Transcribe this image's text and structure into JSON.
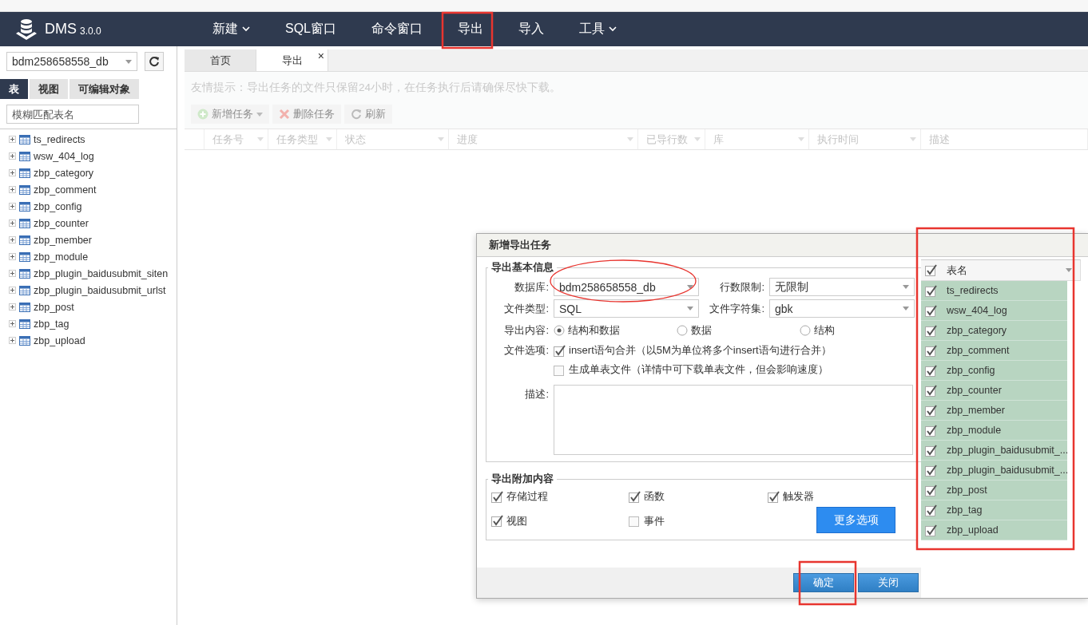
{
  "nav": {
    "brand": "DMS",
    "version": "3.0.0",
    "menu": [
      {
        "label": "新建",
        "dropdown": true
      },
      {
        "label": "SQL窗口",
        "dropdown": false
      },
      {
        "label": "命令窗口",
        "dropdown": false
      },
      {
        "label": "导出",
        "dropdown": false
      },
      {
        "label": "导入",
        "dropdown": false
      },
      {
        "label": "工具",
        "dropdown": true
      }
    ]
  },
  "sidebar": {
    "database": "bdm258658558_db",
    "tabs": [
      {
        "label": "表",
        "selected": true
      },
      {
        "label": "视图",
        "selected": false
      },
      {
        "label": "可编辑对象",
        "selected": false
      }
    ],
    "search_placeholder": "模糊匹配表名",
    "tables": [
      "ts_redirects",
      "wsw_404_log",
      "zbp_category",
      "zbp_comment",
      "zbp_config",
      "zbp_counter",
      "zbp_member",
      "zbp_module",
      "zbp_plugin_baidusubmit_siten",
      "zbp_plugin_baidusubmit_urlst",
      "zbp_post",
      "zbp_tag",
      "zbp_upload"
    ]
  },
  "main": {
    "tabs": [
      {
        "label": "首页",
        "selected": false,
        "closable": false
      },
      {
        "label": "导出",
        "selected": true,
        "closable": true
      }
    ],
    "close_glyph": "×",
    "tip": "友情提示：导出任务的文件只保留24小时，在任务执行后请确保尽快下载。",
    "toolbar": [
      {
        "label": "新增任务",
        "dropdown": true
      },
      {
        "label": "删除任务",
        "dropdown": false
      },
      {
        "label": "刷新",
        "dropdown": false
      }
    ],
    "columns": [
      "任务号",
      "任务类型",
      "状态",
      "进度",
      "已导行数",
      "库",
      "执行时间",
      "描述"
    ]
  },
  "dialog": {
    "title": "新增导出任务",
    "basic_section": "导出基本信息",
    "fields": [
      {
        "label": "数据库:",
        "value": "bdm258658558_db"
      },
      {
        "label": "行数限制:",
        "value": "无限制"
      },
      {
        "label": "文件类型:",
        "value": "SQL"
      },
      {
        "label": "文件字符集:",
        "value": "gbk"
      }
    ],
    "content_label": "导出内容:",
    "content_options": [
      {
        "label": "结构和数据",
        "selected": true
      },
      {
        "label": "数据",
        "selected": false
      },
      {
        "label": "结构",
        "selected": false
      }
    ],
    "file_options_label": "文件选项:",
    "file_options": [
      {
        "label": "insert语句合并（以5M为单位将多个insert语句进行合并）",
        "checked": true
      },
      {
        "label": "生成单表文件（详情中可下载单表文件，但会影响速度）",
        "checked": false
      }
    ],
    "description_label": "描述:",
    "extra_section": "导出附加内容",
    "extras": [
      {
        "label": "存储过程",
        "checked": true
      },
      {
        "label": "函数",
        "checked": true
      },
      {
        "label": "触发器",
        "checked": true
      },
      {
        "label": "视图",
        "checked": true
      },
      {
        "label": "事件",
        "checked": false
      }
    ],
    "more_button": "更多选项",
    "table_list": {
      "header": "表名",
      "all_checked": true,
      "rows": [
        {
          "name": "ts_redirects",
          "checked": true
        },
        {
          "name": "wsw_404_log",
          "checked": true
        },
        {
          "name": "zbp_category",
          "checked": true
        },
        {
          "name": "zbp_comment",
          "checked": true
        },
        {
          "name": "zbp_config",
          "checked": true
        },
        {
          "name": "zbp_counter",
          "checked": true
        },
        {
          "name": "zbp_member",
          "checked": true
        },
        {
          "name": "zbp_module",
          "checked": true
        },
        {
          "name": "zbp_plugin_baidusubmit_...",
          "checked": true
        },
        {
          "name": "zbp_plugin_baidusubmit_...",
          "checked": true
        },
        {
          "name": "zbp_post",
          "checked": true
        },
        {
          "name": "zbp_tag",
          "checked": true
        },
        {
          "name": "zbp_upload",
          "checked": true
        }
      ]
    },
    "buttons": [
      "确定",
      "关闭"
    ]
  }
}
